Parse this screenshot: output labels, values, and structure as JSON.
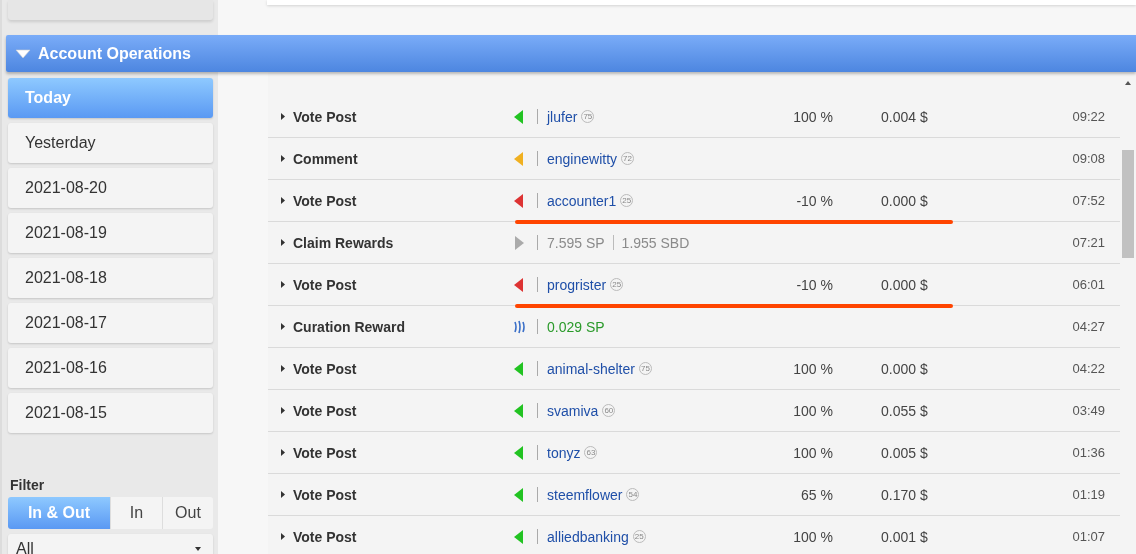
{
  "section": {
    "title": "Account Operations",
    "expanded": true
  },
  "dates": [
    {
      "label": "Today",
      "selected": true
    },
    {
      "label": "Yesterday",
      "selected": false
    },
    {
      "label": "2021-08-20",
      "selected": false
    },
    {
      "label": "2021-08-19",
      "selected": false
    },
    {
      "label": "2021-08-18",
      "selected": false
    },
    {
      "label": "2021-08-17",
      "selected": false
    },
    {
      "label": "2021-08-16",
      "selected": false
    },
    {
      "label": "2021-08-15",
      "selected": false
    }
  ],
  "filter": {
    "label": "Filter",
    "options": [
      {
        "label": "In & Out",
        "selected": true
      },
      {
        "label": "In",
        "selected": false
      },
      {
        "label": "Out",
        "selected": false
      }
    ],
    "dropdown": "All"
  },
  "rows": [
    {
      "type": "Vote Post",
      "kind": "upvote",
      "account": "jlufer",
      "reputation": "75",
      "percent": "100 %",
      "value": "0.004 $",
      "time": "09:22",
      "underlined": false
    },
    {
      "type": "Comment",
      "kind": "comment",
      "account": "enginewitty",
      "reputation": "72",
      "time": "09:08",
      "underlined": false
    },
    {
      "type": "Vote Post",
      "kind": "downvote",
      "account": "accounter1",
      "reputation": "25",
      "percent": "-10 %",
      "value": "0.000 $",
      "time": "07:52",
      "underlined": true
    },
    {
      "type": "Claim Rewards",
      "kind": "claim",
      "amounts": [
        "7.595 SP",
        "1.955 SBD"
      ],
      "time": "07:21",
      "underlined": false
    },
    {
      "type": "Vote Post",
      "kind": "downvote",
      "account": "progrister",
      "reputation": "25",
      "percent": "-10 %",
      "value": "0.000 $",
      "time": "06:01",
      "underlined": true
    },
    {
      "type": "Curation Reward",
      "kind": "curation",
      "amounts": [
        "0.029 SP"
      ],
      "time": "04:27",
      "underlined": false
    },
    {
      "type": "Vote Post",
      "kind": "upvote",
      "account": "animal-shelter",
      "reputation": "75",
      "percent": "100 %",
      "value": "0.000 $",
      "time": "04:22",
      "underlined": false
    },
    {
      "type": "Vote Post",
      "kind": "upvote",
      "account": "svamiva",
      "reputation": "60",
      "percent": "100 %",
      "value": "0.055 $",
      "time": "03:49",
      "underlined": false
    },
    {
      "type": "Vote Post",
      "kind": "upvote",
      "account": "tonyz",
      "reputation": "63",
      "percent": "100 %",
      "value": "0.005 $",
      "time": "01:36",
      "underlined": false
    },
    {
      "type": "Vote Post",
      "kind": "upvote",
      "account": "steemflower",
      "reputation": "54",
      "percent": "65 %",
      "value": "0.170 $",
      "time": "01:19",
      "underlined": false
    },
    {
      "type": "Vote Post",
      "kind": "upvote",
      "account": "alliedbanking",
      "reputation": "25",
      "percent": "100 %",
      "value": "0.001 $",
      "time": "01:07",
      "underlined": false
    }
  ]
}
